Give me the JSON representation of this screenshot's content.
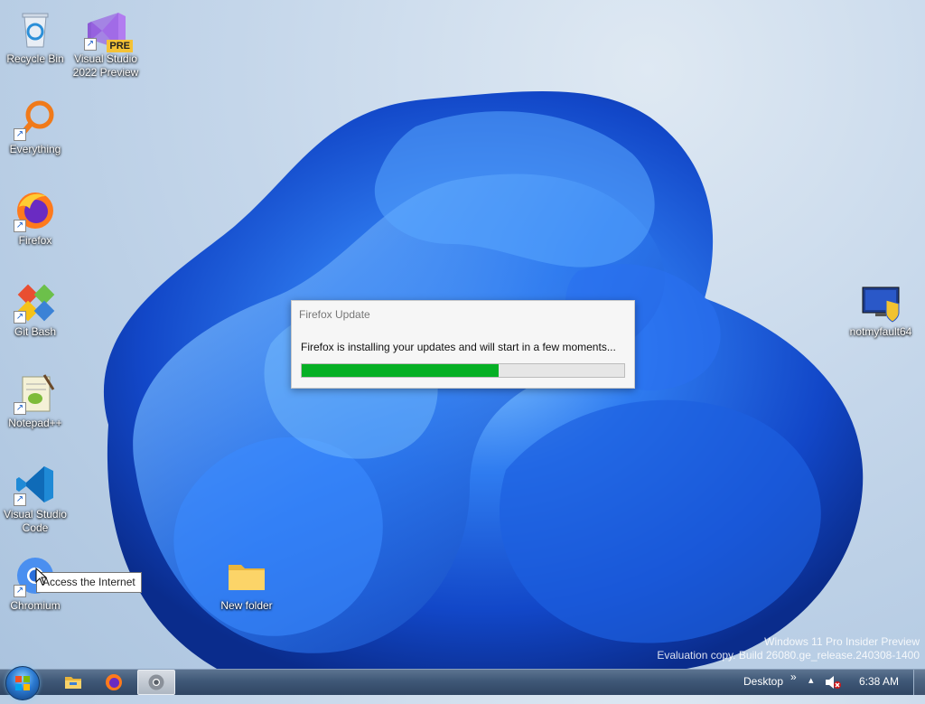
{
  "desktop": {
    "icons": [
      {
        "label": "Recycle Bin",
        "icon": "recycle-bin-icon"
      },
      {
        "label": "Visual Studio 2022 Preview",
        "icon": "visual-studio-preview-icon",
        "badge": "PRE"
      },
      {
        "label": "Everything",
        "icon": "everything-search-icon"
      },
      {
        "label": "Firefox",
        "icon": "firefox-icon"
      },
      {
        "label": "Git Bash",
        "icon": "git-bash-icon"
      },
      {
        "label": "Notepad++",
        "icon": "notepad-plus-plus-icon"
      },
      {
        "label": "Visual Studio Code",
        "icon": "vscode-icon"
      },
      {
        "label": "Chromium",
        "icon": "chromium-icon"
      },
      {
        "label": "New folder",
        "icon": "folder-icon"
      },
      {
        "label": "notmyfault64",
        "icon": "notmyfault-icon"
      }
    ]
  },
  "dialog": {
    "title": "Firefox Update",
    "message": "Firefox is installing your updates and will start in a few moments...",
    "progress": 0.61,
    "progress_color": "#06b025"
  },
  "tooltip": {
    "text": "Access the Internet"
  },
  "watermark": {
    "line1": "Windows 11 Pro Insider Preview",
    "line2": "Evaluation copy. Build 26080.ge_release.240308-1400"
  },
  "taskbar": {
    "pinned": [
      "file-explorer-icon",
      "firefox-icon",
      "chromium-icon"
    ],
    "desktop_label": "Desktop",
    "overflow_chevron": "»",
    "tray_arrow": "▴",
    "clock": "6:38 AM"
  }
}
